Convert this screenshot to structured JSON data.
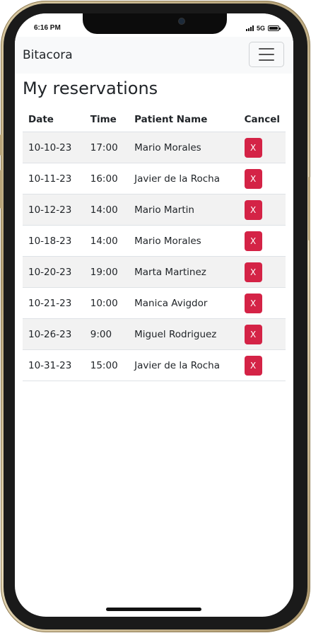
{
  "status_bar": {
    "time": "6:16 PM",
    "network": "5G"
  },
  "navbar": {
    "brand": "Bitacora"
  },
  "page": {
    "title": "My reservations"
  },
  "table": {
    "headers": {
      "date": "Date",
      "time": "Time",
      "patient": "Patient Name",
      "cancel": "Cancel"
    },
    "cancel_label": "X",
    "rows": [
      {
        "date": "10-10-23",
        "time": "17:00",
        "patient": "Mario Morales"
      },
      {
        "date": "10-11-23",
        "time": "16:00",
        "patient": "Javier de la Rocha"
      },
      {
        "date": "10-12-23",
        "time": "14:00",
        "patient": "Mario Martin"
      },
      {
        "date": "10-18-23",
        "time": "14:00",
        "patient": "Mario Morales"
      },
      {
        "date": "10-20-23",
        "time": "19:00",
        "patient": "Marta Martinez"
      },
      {
        "date": "10-21-23",
        "time": "10:00",
        "patient": "Manica Avigdor"
      },
      {
        "date": "10-26-23",
        "time": "9:00",
        "patient": "Miguel Rodriguez"
      },
      {
        "date": "10-31-23",
        "time": "15:00",
        "patient": "Javier de la Rocha"
      }
    ]
  },
  "colors": {
    "cancel_button": "#d42346",
    "navbar_bg": "#f8f9fa",
    "striped_row": "#f2f2f2"
  }
}
